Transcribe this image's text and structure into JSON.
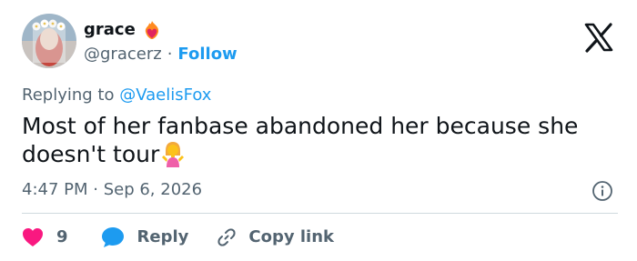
{
  "user": {
    "display_name": "grace",
    "handle": "@gracerz",
    "separator": "·",
    "follow_label": "Follow"
  },
  "reply_context": {
    "prefix": "Replying to",
    "mention": "@VaelisFox"
  },
  "tweet": {
    "text": "Most of her fanbase abandoned her because she doesn't tour",
    "timestamp": "4:47 PM · Sep 6, 2026"
  },
  "actions": {
    "like_count": "9",
    "reply_label": "Reply",
    "copy_link_label": "Copy link"
  },
  "icons": {
    "logo": "x-logo-icon",
    "name_emoji": "heart-on-fire-icon",
    "text_emoji": "person-shrugging-icon",
    "info": "info-icon",
    "like": "heart-icon",
    "reply": "speech-bubble-icon",
    "copy": "link-icon"
  },
  "colors": {
    "link_blue": "#1d9bf0",
    "like_pink": "#f91880",
    "text_primary": "#0f1419",
    "text_secondary": "#536471",
    "divider": "#cfd9de"
  }
}
